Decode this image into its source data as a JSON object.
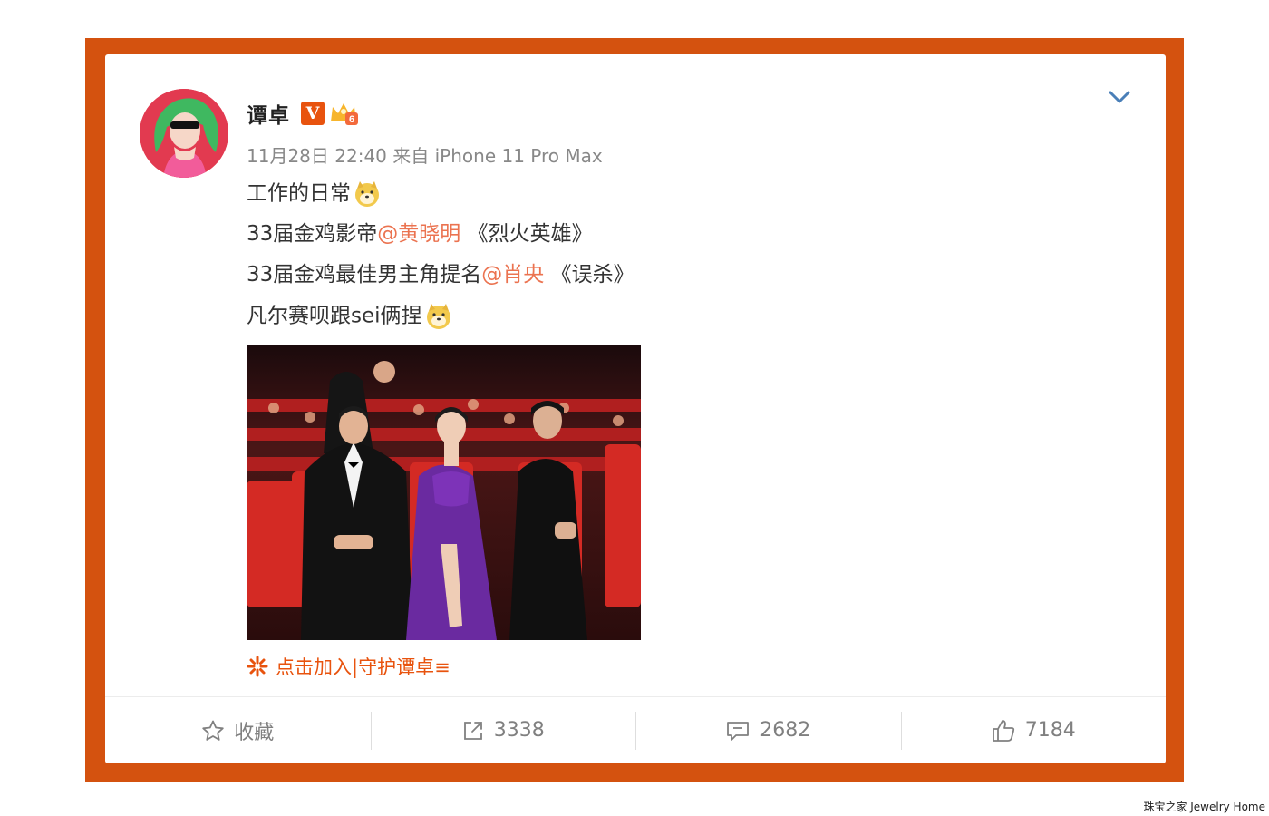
{
  "post": {
    "author": "谭卓",
    "verified_badge": "V",
    "level_badge": "6",
    "time": "11月28日 22:40",
    "source": "来自 iPhone 11 Pro Max",
    "lines": [
      {
        "text": "工作的日常"
      },
      {
        "prefix": "33届金鸡影帝",
        "mention": "@黄晓明",
        "suffix": " 《烈火英雄》"
      },
      {
        "prefix": "33届金鸡最佳男主角提名",
        "mention": "@肖央",
        "suffix": " 《误杀》"
      },
      {
        "text": "凡尔赛呗跟sei俩捏"
      }
    ],
    "join_link": "点击加入|守护谭卓≡"
  },
  "actions": {
    "favorite_label": "收藏",
    "repost_count": "3338",
    "comment_count": "2682",
    "like_count": "7184"
  },
  "icons": {
    "menu": "chevron-down-icon",
    "favorite": "star-icon",
    "repost": "share-icon",
    "comment": "comment-icon",
    "like": "thumbs-up-icon",
    "join": "sparkle-icon"
  },
  "colors": {
    "frame": "#d4520f",
    "mention": "#eb7350",
    "accent": "#e8530e",
    "meta": "#888888"
  },
  "watermark": "珠宝之家 Jewelry Home"
}
